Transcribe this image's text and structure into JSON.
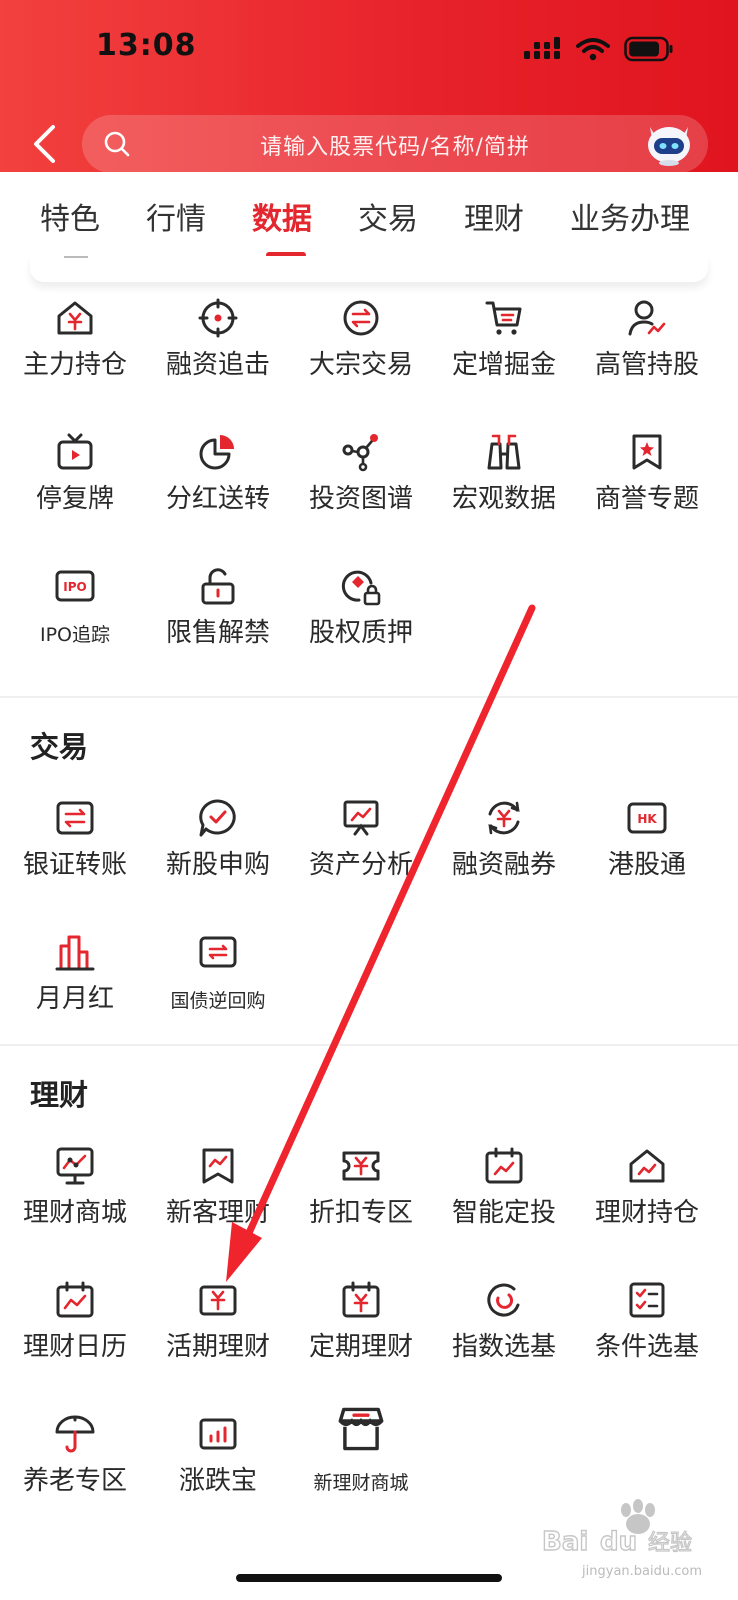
{
  "status_bar": {
    "time": "13:08"
  },
  "search": {
    "placeholder": "请输入股票代码/名称/简拼"
  },
  "tabs": [
    {
      "label": "特色"
    },
    {
      "label": "行情"
    },
    {
      "label": "数据",
      "active": true
    },
    {
      "label": "交易"
    },
    {
      "label": "理财"
    },
    {
      "label": "业务办理"
    }
  ],
  "sections": {
    "data": {
      "items": [
        {
          "label": "主力持仓",
          "icon": "house-yuan-icon"
        },
        {
          "label": "融资追击",
          "icon": "target-icon"
        },
        {
          "label": "大宗交易",
          "icon": "exchange-circle-icon"
        },
        {
          "label": "定增掘金",
          "icon": "cart-icon"
        },
        {
          "label": "高管持股",
          "icon": "person-chart-icon"
        },
        {
          "label": "停复牌",
          "icon": "tv-play-icon"
        },
        {
          "label": "分红送转",
          "icon": "pie-chart-icon"
        },
        {
          "label": "投资图谱",
          "icon": "network-icon"
        },
        {
          "label": "宏观数据",
          "icon": "binoculars-icon"
        },
        {
          "label": "商誉专题",
          "icon": "bookmark-star-icon"
        },
        {
          "label": "IPO追踪",
          "icon": "ipo-icon"
        },
        {
          "label": "限售解禁",
          "icon": "unlock-icon"
        },
        {
          "label": "股权质押",
          "icon": "coin-lock-icon"
        }
      ]
    },
    "trade": {
      "title": "交易",
      "items": [
        {
          "label": "银证转账",
          "icon": "transfer-icon"
        },
        {
          "label": "新股申购",
          "icon": "chat-check-icon"
        },
        {
          "label": "资产分析",
          "icon": "presentation-icon"
        },
        {
          "label": "融资融券",
          "icon": "yuan-cycle-icon"
        },
        {
          "label": "港股通",
          "icon": "hk-icon"
        },
        {
          "label": "月月红",
          "icon": "bar-building-icon"
        },
        {
          "label": "国债逆回购",
          "icon": "reverse-repo-icon"
        }
      ]
    },
    "finance": {
      "title": "理财",
      "items": [
        {
          "label": "理财商城",
          "icon": "monitor-chart-icon"
        },
        {
          "label": "新客理财",
          "icon": "bookmark-chart-icon"
        },
        {
          "label": "折扣专区",
          "icon": "ticket-yuan-icon"
        },
        {
          "label": "智能定投",
          "icon": "calendar-trend-icon"
        },
        {
          "label": "理财持仓",
          "icon": "house-chart-icon"
        },
        {
          "label": "理财日历",
          "icon": "calendar-chart-icon"
        },
        {
          "label": "活期理财",
          "icon": "yuan-card-icon"
        },
        {
          "label": "定期理财",
          "icon": "calendar-yuan-icon"
        },
        {
          "label": "指数选基",
          "icon": "swirl-icon"
        },
        {
          "label": "条件选基",
          "icon": "checklist-icon"
        },
        {
          "label": "养老专区",
          "icon": "umbrella-icon"
        },
        {
          "label": "涨跌宝",
          "icon": "small-bars-icon"
        },
        {
          "label": "新理财商城",
          "icon": "shop-icon"
        }
      ]
    }
  },
  "colors": {
    "brand_red": "#e4262e",
    "icon_dark": "#2b2b2b"
  },
  "watermark": {
    "text": "jingyan.baidu.com"
  }
}
